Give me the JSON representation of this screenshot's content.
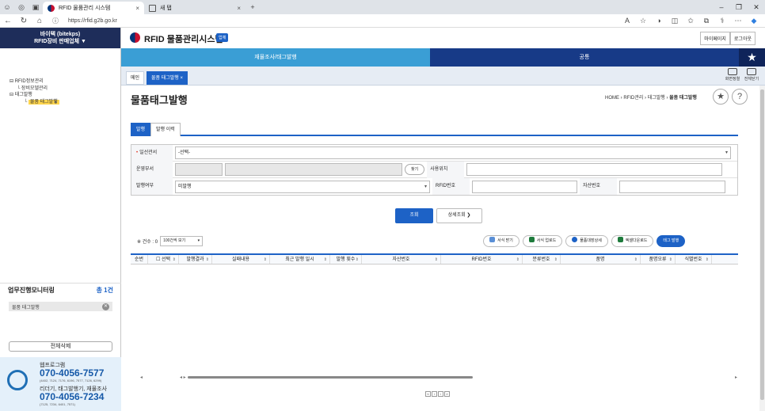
{
  "browser": {
    "tab_active": "RFID 물품관리 시스템",
    "tab_new": "새 탭",
    "url": "https://rfid.g2b.go.kr"
  },
  "sidebar": {
    "company": "바이텍 (bitekps)",
    "role": "RFID장비 판매업체 ▼",
    "tree": [
      {
        "label": "RFID정보관리",
        "level": 1,
        "selected": false
      },
      {
        "label": "장비모델관리",
        "level": 2,
        "selected": false
      },
      {
        "label": "태그발행",
        "level": 1,
        "selected": false
      },
      {
        "label": "물품 태그발행",
        "level": 3,
        "selected": true
      }
    ],
    "monitor": {
      "title": "업무진행모니터링",
      "count": "총 1건",
      "items": [
        "물품 태그발행"
      ]
    },
    "delete_all": "전체삭제",
    "support": {
      "label1": "웹프로그램",
      "phone1": "070-4056-7577",
      "ext1": "(4402, 7124, 7176, 6196, 7577, 7126, 6299)",
      "label2": "리더기, 태그발행기, 재물조사",
      "phone2": "070-4056-7234",
      "ext2": "(7125, 7234, 6401, 7571)"
    }
  },
  "header": {
    "title": "RFID 물품관리시스템",
    "badge": "업체",
    "mypage": "마이페이지",
    "logout": "로그아웃"
  },
  "menu": {
    "item1": "재물조사/태그발행",
    "item2": "공통",
    "star": "★"
  },
  "pagetabs": {
    "main": "메인",
    "current": "물품 태그발행 ×",
    "tool1": "화면정렬",
    "tool2": "전체닫기"
  },
  "page": {
    "title": "물품태그발행",
    "breadcrumb_prefix": "HOME › RFID관리 › 태그발행 ›",
    "breadcrumb_current": "물품 태그발행",
    "subtab_issue": "발행",
    "subtab_history": "발행 이력"
  },
  "form": {
    "dept_label": "일선관서",
    "dept_value": "-선택-",
    "opdept_label": "운영부서",
    "find_btn": "찾기",
    "location_label": "사용위치",
    "issued_label": "발행여부",
    "issued_value": "미발행",
    "rfid_label": "RFID번호",
    "asset_label": "자산번호",
    "search_btn": "조회",
    "detail_btn": "상세조회 ❯"
  },
  "grid": {
    "count_text": "※ 건수 : 0",
    "page_size": "100건씩 보기",
    "buttons": {
      "form_download": "서식 받기",
      "form_upload": "서식 업로드",
      "target_detail": "물품대장상세",
      "excel_download": "엑셀다운로드",
      "tag_issue": "태그 발행"
    },
    "columns": [
      "순번",
      "☐ 선택",
      "발행결과",
      "실패내용",
      "최근 발행 일시",
      "발행 횟수",
      "자산번호",
      "RFID번호",
      "분류번호",
      "품명",
      "품명오류",
      "식별번호"
    ],
    "sortable": [
      false,
      true,
      true,
      true,
      true,
      true,
      true,
      true,
      true,
      true,
      true,
      true
    ]
  },
  "colors": {
    "primary": "#1d62c6",
    "menu_light": "#3a9ed5",
    "menu_dark": "#173a87",
    "sidebar_top": "#1e2d5a",
    "highlight": "#ffd64d"
  }
}
